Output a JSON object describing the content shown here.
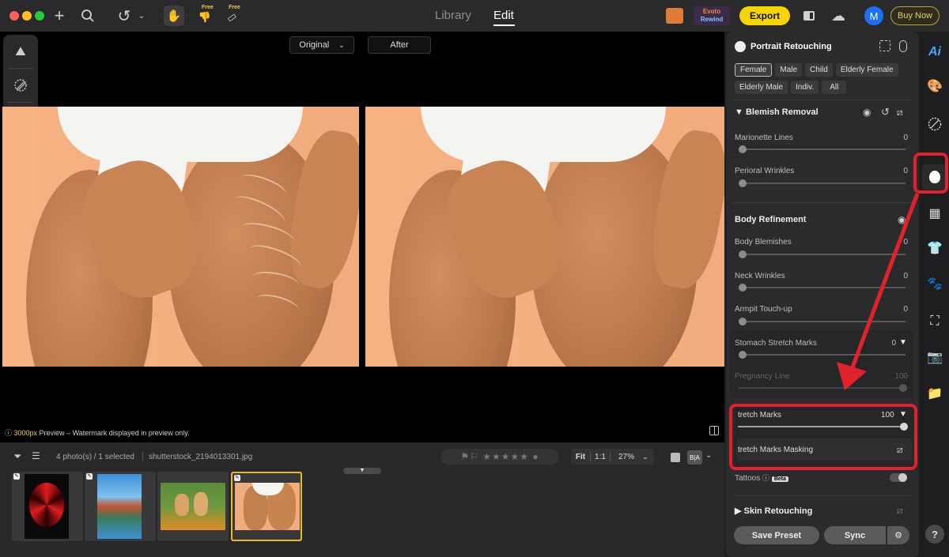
{
  "topbar": {
    "free_labels": [
      "Free",
      "Free"
    ],
    "tabs": {
      "library": "Library",
      "edit": "Edit"
    },
    "export_label": "Export",
    "buy_now_label": "Buy Now",
    "avatar_letter": "M",
    "rewind_label_1": "Evoto",
    "rewind_label_2": "Rewind"
  },
  "canvas": {
    "original_label": "Original",
    "after_label": "After",
    "preview_resolution": "3000px",
    "preview_note": " Preview – Watermark displayed in preview only."
  },
  "filmstrip": {
    "count_text": "4 photo(s) / 1 selected",
    "filename": "shutterstock_2194013301.jpg",
    "fit_label": "Fit",
    "one_to_one_label": "1:1",
    "zoom_value": "27%",
    "ba_label": "B|A"
  },
  "panel": {
    "title": "Portrait Retouching",
    "chips_row1": [
      "Female",
      "Male",
      "Child",
      "Elderly Female"
    ],
    "chips_row2": [
      "Elderly Male",
      "Indiv.",
      "All"
    ],
    "blemish_title": "Blemish Removal",
    "blemish_sliders": [
      {
        "label": "Marionette Lines",
        "value": "0"
      },
      {
        "label": "Perioral Wrinkles",
        "value": "0"
      }
    ],
    "body_title": "Body Refinement",
    "body_sliders": [
      {
        "label": "Body Blemishes",
        "value": "0"
      },
      {
        "label": "Neck Wrinkles",
        "value": "0"
      },
      {
        "label": "Armpit Touch-up",
        "value": "0"
      },
      {
        "label": "Stomach Stretch Marks",
        "value": "0"
      },
      {
        "label": "Pregnancy Line",
        "value": "100"
      }
    ],
    "stretch_label": "tretch Marks",
    "stretch_value": "100",
    "stretch_masking_label": "tretch Marks Masking",
    "tattoos_label": "Tattoos",
    "tattoos_badge": "Beta",
    "skin_title": "Skin Retouching",
    "save_preset_label": "Save Preset",
    "sync_label": "Sync"
  },
  "rail": {
    "ai_label": "Ai",
    "help_label": "?"
  },
  "colors": {
    "accent_yellow": "#f5d50a",
    "highlight_red": "#e0232a",
    "avatar_blue": "#1d6ff2"
  }
}
